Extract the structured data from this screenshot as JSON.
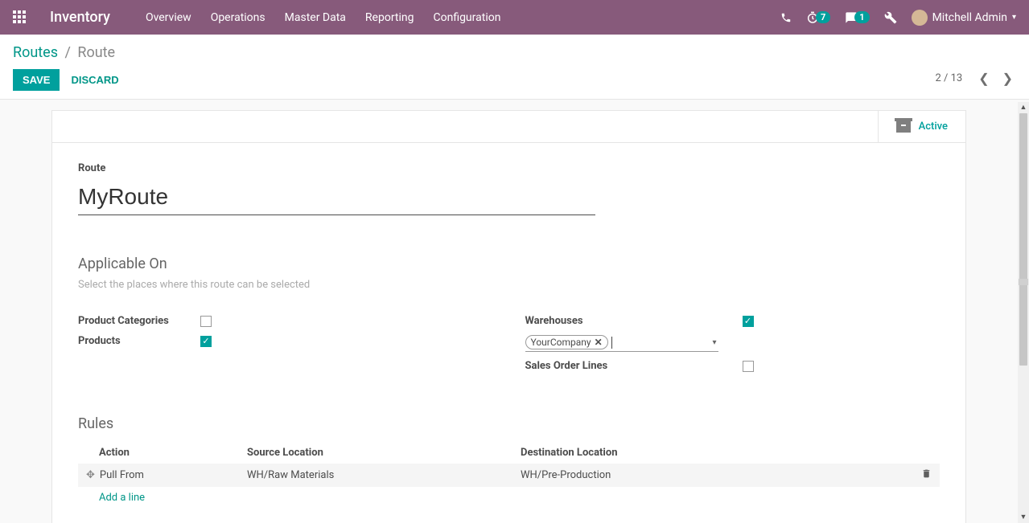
{
  "app": {
    "name": "Inventory"
  },
  "nav": {
    "items": [
      "Overview",
      "Operations",
      "Master Data",
      "Reporting",
      "Configuration"
    ]
  },
  "systray": {
    "timer_badge": "7",
    "chat_badge": "1",
    "user_name": "Mitchell Admin"
  },
  "breadcrumb": {
    "parent": "Routes",
    "current": "Route"
  },
  "buttons": {
    "save": "SAVE",
    "discard": "DISCARD"
  },
  "pager": {
    "text": "2 / 13"
  },
  "stat_button": {
    "label": "Active"
  },
  "form": {
    "route_label": "Route",
    "route_value": "MyRoute",
    "applicable_on_title": "Applicable On",
    "applicable_on_hint": "Select the places where this route can be selected",
    "product_categories_label": "Product Categories",
    "products_label": "Products",
    "warehouses_label": "Warehouses",
    "warehouse_tag": "YourCompany",
    "sales_order_lines_label": "Sales Order Lines",
    "rules_title": "Rules",
    "rules_headers": {
      "action": "Action",
      "source": "Source Location",
      "dest": "Destination Location"
    },
    "rules_rows": [
      {
        "action": "Pull From",
        "source": "WH/Raw Materials",
        "dest": "WH/Pre-Production"
      }
    ],
    "add_line": "Add a line"
  }
}
